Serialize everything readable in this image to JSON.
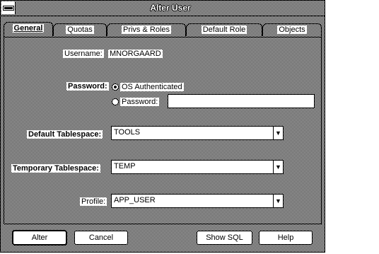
{
  "window": {
    "title": "Alter User"
  },
  "tabs": [
    {
      "label": "General",
      "active": true
    },
    {
      "label": "Quotas",
      "active": false
    },
    {
      "label": "Privs & Roles",
      "active": false
    },
    {
      "label": "Default Role",
      "active": false
    },
    {
      "label": "Objects",
      "active": false
    }
  ],
  "general": {
    "username_label": "Username:",
    "username_value": "MNORGAARD",
    "password_label": "Password:",
    "os_auth_label": "OS Authenticated",
    "password_option_label": "Password:",
    "password_value": "",
    "default_ts_label": "Default Tablespace:",
    "default_ts_value": "TOOLS",
    "temp_ts_label": "Temporary Tablespace:",
    "temp_ts_value": "TEMP",
    "profile_label": "Profile:",
    "profile_value": "APP_USER",
    "selected_auth": "os-authenticated"
  },
  "buttons": {
    "alter": "Alter",
    "cancel": "Cancel",
    "show_sql": "Show SQL",
    "help": "Help"
  },
  "icons": {
    "combo_arrow": "down-arrow-icon",
    "system_menu": "system-menu-icon"
  }
}
